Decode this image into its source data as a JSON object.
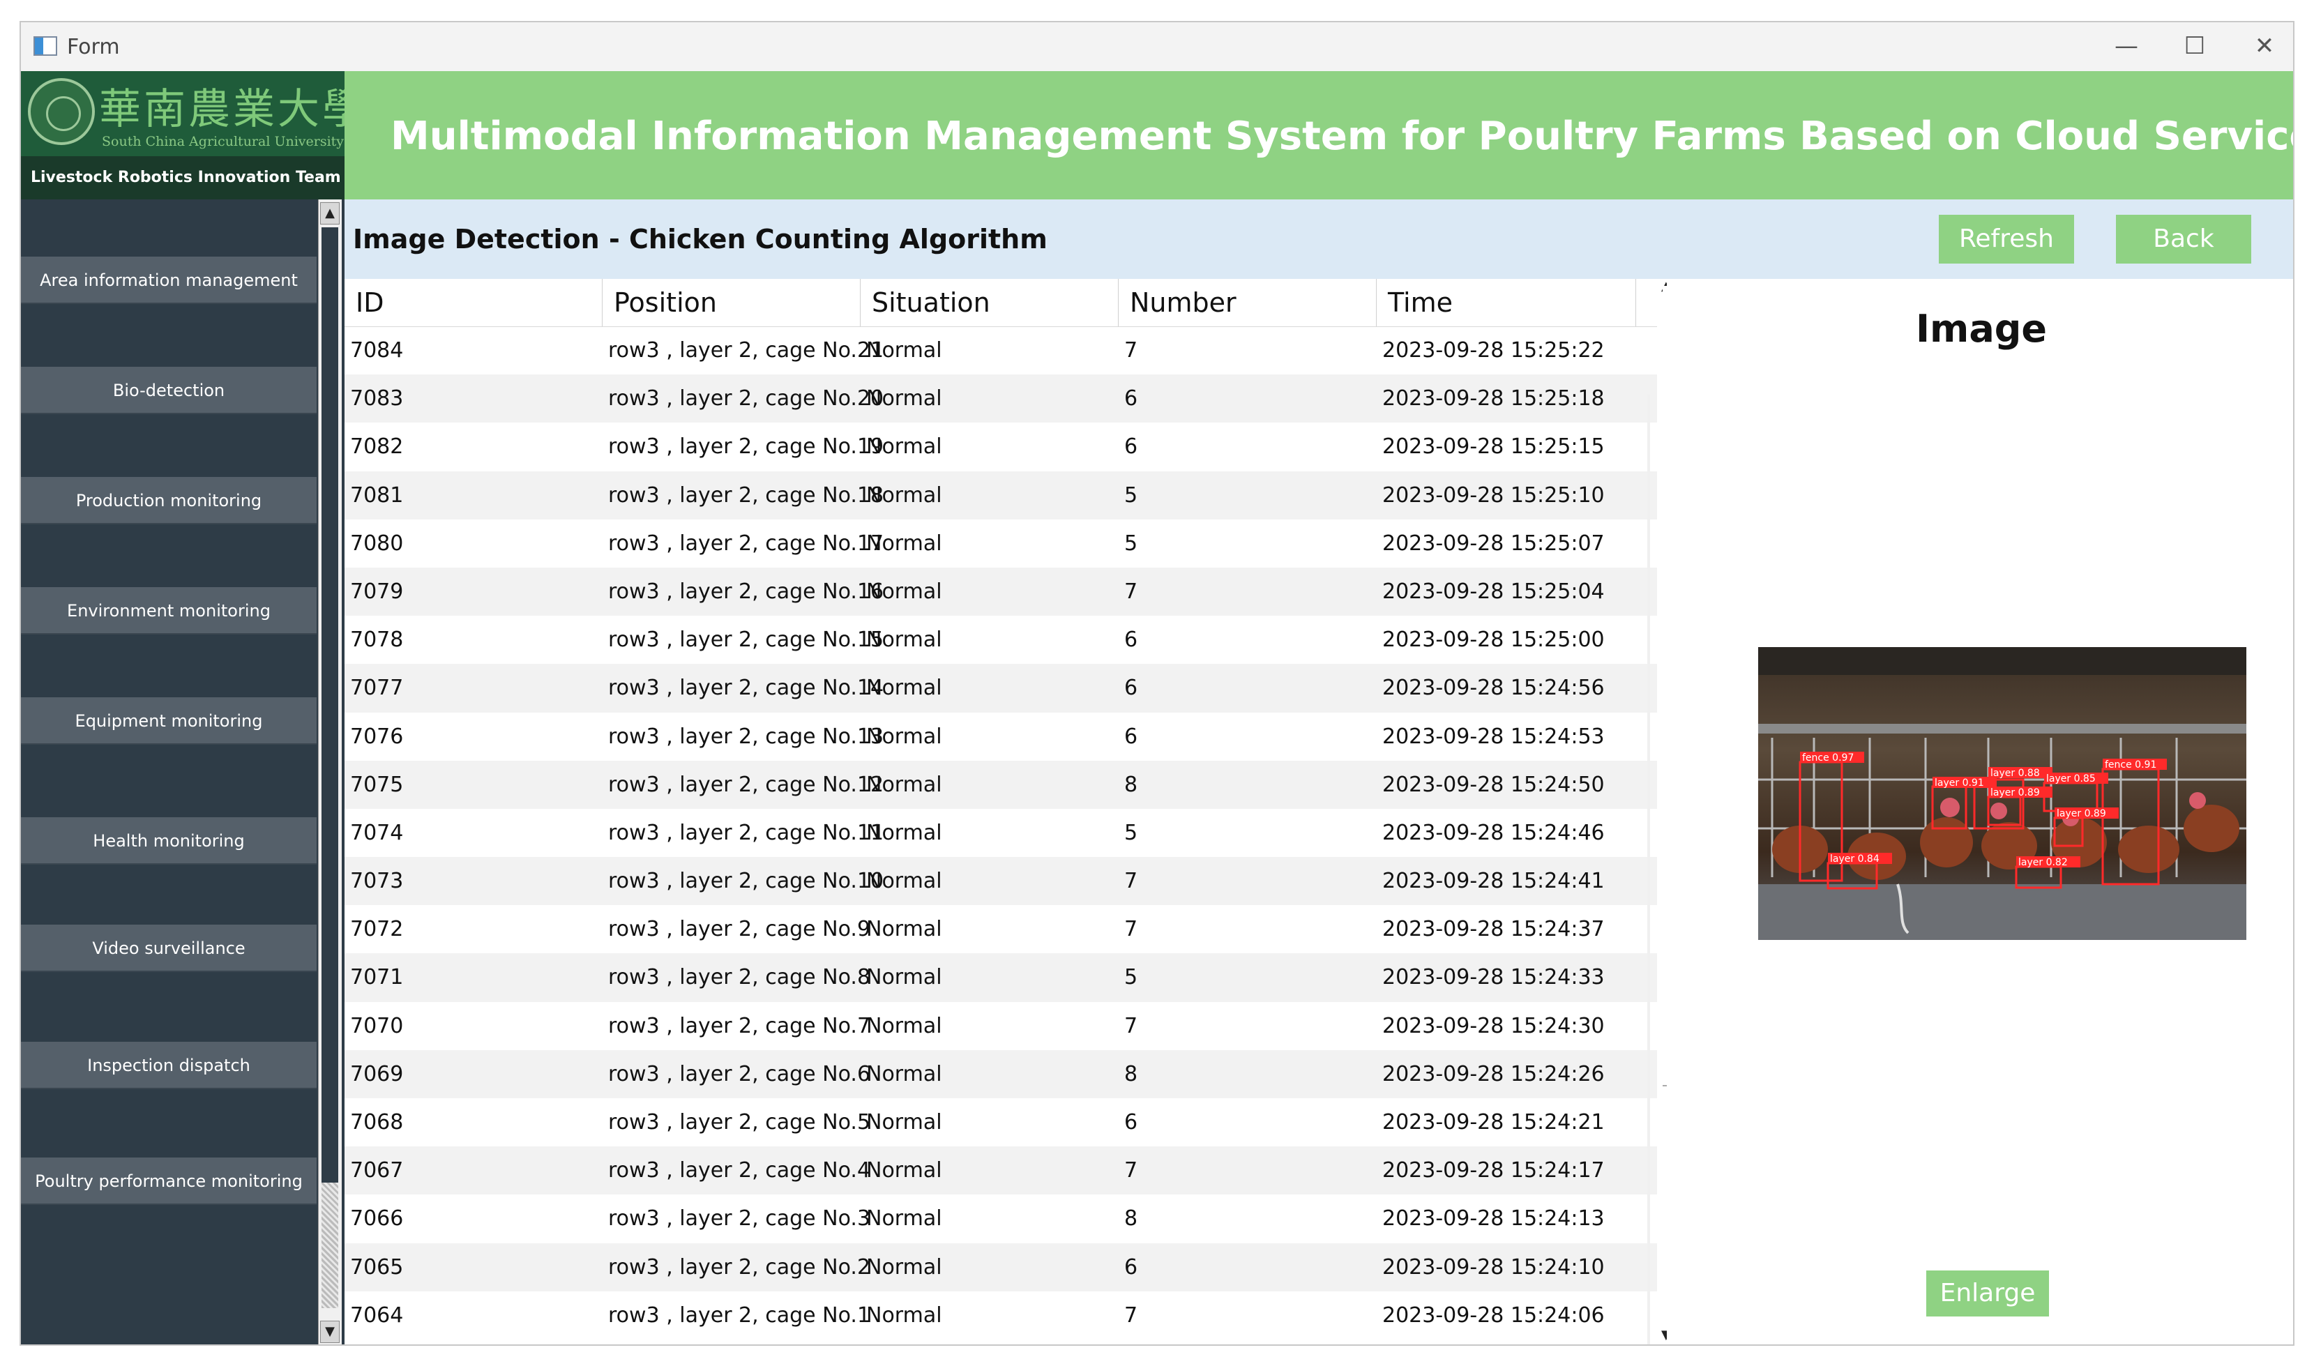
{
  "window": {
    "title": "Form",
    "controls": [
      "minimize",
      "maximize",
      "close"
    ]
  },
  "logo": {
    "cn_name": "華南農業大學",
    "en_name": "South China Agricultural University",
    "team": "Livestock Robotics Innovation Team"
  },
  "system_title": "Multimodal Information Management System for Poultry Farms Based on Cloud Services",
  "sidebar": {
    "items": [
      {
        "label": "Area information management"
      },
      {
        "label": "Bio-detection"
      },
      {
        "label": "Production monitoring"
      },
      {
        "label": "Environment monitoring"
      },
      {
        "label": "Equipment monitoring"
      },
      {
        "label": "Health monitoring"
      },
      {
        "label": "Video surveillance"
      },
      {
        "label": "Inspection dispatch"
      },
      {
        "label": "Poultry performance monitoring"
      }
    ]
  },
  "page": {
    "title": "Image Detection - Chicken Counting Algorithm",
    "refresh_label": "Refresh",
    "back_label": "Back"
  },
  "table": {
    "columns": [
      "ID",
      "Position",
      "Situation",
      "Number",
      "Time"
    ],
    "rows": [
      [
        "7084",
        "row3 , layer 2, cage No.21",
        "Normal",
        "7",
        "2023-09-28 15:25:22"
      ],
      [
        "7083",
        "row3 , layer 2, cage No.20",
        "Normal",
        "6",
        "2023-09-28 15:25:18"
      ],
      [
        "7082",
        "row3 , layer 2, cage No.19",
        "Normal",
        "6",
        "2023-09-28 15:25:15"
      ],
      [
        "7081",
        "row3 , layer 2, cage No.18",
        "Normal",
        "5",
        "2023-09-28 15:25:10"
      ],
      [
        "7080",
        "row3 , layer 2, cage No.17",
        "Normal",
        "5",
        "2023-09-28 15:25:07"
      ],
      [
        "7079",
        "row3 , layer 2, cage No.16",
        "Normal",
        "7",
        "2023-09-28 15:25:04"
      ],
      [
        "7078",
        "row3 , layer 2, cage No.15",
        "Normal",
        "6",
        "2023-09-28 15:25:00"
      ],
      [
        "7077",
        "row3 , layer 2, cage No.14",
        "Normal",
        "6",
        "2023-09-28 15:24:56"
      ],
      [
        "7076",
        "row3 , layer 2, cage No.13",
        "Normal",
        "6",
        "2023-09-28 15:24:53"
      ],
      [
        "7075",
        "row3 , layer 2, cage No.12",
        "Normal",
        "8",
        "2023-09-28 15:24:50"
      ],
      [
        "7074",
        "row3 , layer 2, cage No.11",
        "Normal",
        "5",
        "2023-09-28 15:24:46"
      ],
      [
        "7073",
        "row3 , layer 2, cage No.10",
        "Normal",
        "7",
        "2023-09-28 15:24:41"
      ],
      [
        "7072",
        "row3 , layer 2, cage No.9",
        "Normal",
        "7",
        "2023-09-28 15:24:37"
      ],
      [
        "7071",
        "row3 , layer 2, cage No.8",
        "Normal",
        "5",
        "2023-09-28 15:24:33"
      ],
      [
        "7070",
        "row3 , layer 2, cage No.7",
        "Normal",
        "7",
        "2023-09-28 15:24:30"
      ],
      [
        "7069",
        "row3 , layer 2, cage No.6",
        "Normal",
        "8",
        "2023-09-28 15:24:26"
      ],
      [
        "7068",
        "row3 , layer 2, cage No.5",
        "Normal",
        "6",
        "2023-09-28 15:24:21"
      ],
      [
        "7067",
        "row3 , layer 2, cage No.4",
        "Normal",
        "7",
        "2023-09-28 15:24:17"
      ],
      [
        "7066",
        "row3 , layer 2, cage No.3",
        "Normal",
        "8",
        "2023-09-28 15:24:13"
      ],
      [
        "7065",
        "row3 , layer 2, cage No.2",
        "Normal",
        "6",
        "2023-09-28 15:24:10"
      ],
      [
        "7064",
        "row3 , layer 2, cage No.1",
        "Normal",
        "7",
        "2023-09-28 15:24:06"
      ]
    ]
  },
  "image_panel": {
    "heading": "Image",
    "enlarge_label": "Enlarge",
    "detections": [
      {
        "label": "fence 0.97"
      },
      {
        "label": "layer 0.84"
      },
      {
        "label": "layer 0.91"
      },
      {
        "label": "layer 0.88"
      },
      {
        "label": "layer 0.89"
      },
      {
        "label": "layer 0.85"
      },
      {
        "label": "fence 0.91"
      },
      {
        "label": "layer 0.89"
      },
      {
        "label": "layer 0.82"
      }
    ]
  },
  "colors": {
    "accent_green": "#8fd283",
    "sidebar_bg": "#2e3c47",
    "nav_item_bg": "#55606a",
    "subheader_bg": "#dbe9f5",
    "detection_box": "#ff2a2a"
  }
}
